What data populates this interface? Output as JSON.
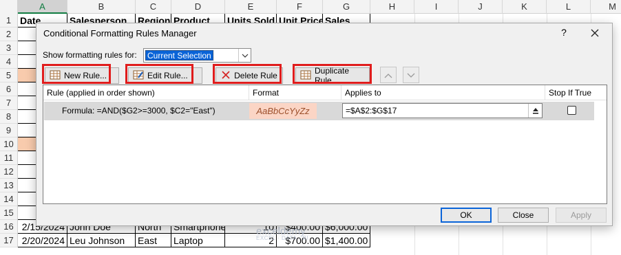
{
  "spreadsheet": {
    "columns": [
      "A",
      "B",
      "C",
      "D",
      "E",
      "F",
      "G",
      "H",
      "I",
      "J",
      "K",
      "L",
      "M"
    ],
    "rows": [
      "1",
      "2",
      "3",
      "4",
      "5",
      "6",
      "7",
      "8",
      "9",
      "10",
      "11",
      "12",
      "13",
      "14",
      "15",
      "16",
      "17"
    ],
    "headers": [
      "Date",
      "Salesperson",
      "Region",
      "Product",
      "Units Sold",
      "Unit Price",
      "Sales"
    ],
    "date_fragments": [
      "1/",
      "1/",
      "1/",
      "1/",
      "1/",
      "1/1",
      "1/1",
      "1/1",
      "2/1",
      "2/1",
      "2/1",
      "2/1",
      "2/1",
      "2/1"
    ],
    "row16": {
      "date": "2/15/2024",
      "salesperson": "John Doe",
      "region": "North",
      "product": "Smartphone",
      "units": "10",
      "price": "$400.00",
      "sales": "$6,000.00"
    },
    "row17": {
      "date": "2/20/2024",
      "salesperson": "Leu Johnson",
      "region": "East",
      "product": "Laptop",
      "units": "2",
      "price": "$700.00",
      "sales": "$1,400.00"
    },
    "highlight_color": "#f8cbad"
  },
  "watermark": {
    "name": "exceldemy",
    "tagline": "EXCEL · DATA · BI"
  },
  "dialog": {
    "title": "Conditional Formatting Rules Manager",
    "help": "?",
    "show_rules_label": "Show formatting rules for:",
    "show_rules_value": "Current Selection",
    "toolbar": {
      "new_rule": "New Rule...",
      "edit_rule": "Edit Rule...",
      "delete_rule": "Delete Rule",
      "duplicate_rule": "Duplicate Rule"
    },
    "list_headers": {
      "rule": "Rule (applied in order shown)",
      "format": "Format",
      "applies_to": "Applies to",
      "stop_if_true": "Stop If True"
    },
    "rules": [
      {
        "formula": "Formula: =AND($G2>=3000, $C2=\"East\")",
        "format_preview": "AaBbCcYyZz",
        "applies_to": "=$A$2:$G$17",
        "stop_if_true": false
      }
    ],
    "buttons": {
      "ok": "OK",
      "close": "Close",
      "apply": "Apply"
    },
    "highlight_color": "#e01c1c",
    "accent_color": "#0a64d8"
  }
}
